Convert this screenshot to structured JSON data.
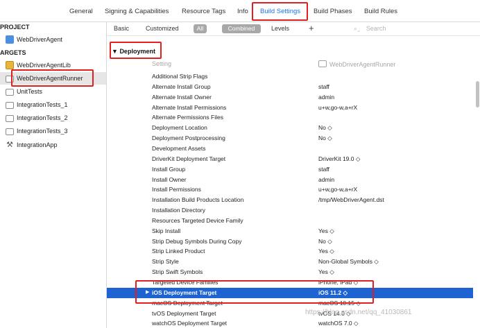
{
  "tabs": {
    "general": "General",
    "signing": "Signing & Capabilities",
    "resource_tags": "Resource Tags",
    "info": "Info",
    "build_settings": "Build Settings",
    "build_phases": "Build Phases",
    "build_rules": "Build Rules"
  },
  "sidebar": {
    "project_header": "PROJECT",
    "project_item": "WebDriverAgent",
    "targets_header": "ARGETS",
    "targets": {
      "t0": "WebDriverAgentLib",
      "t1": "WebDriverAgentRunner",
      "t2": "UnitTests",
      "t3": "IntegrationTests_1",
      "t4": "IntegrationTests_2",
      "t5": "IntegrationTests_3",
      "t6": "IntegrationApp"
    }
  },
  "filter": {
    "basic": "Basic",
    "customized": "Customized",
    "all": "All",
    "combined": "Combined",
    "levels": "Levels",
    "plus": "+",
    "search_placeholder": "Search"
  },
  "section": {
    "title": "Deployment",
    "col_setting": "Setting",
    "col_target": "WebDriverAgentRunner"
  },
  "settings": [
    {
      "name": "Additional Strip Flags",
      "value": ""
    },
    {
      "name": "Alternate Install Group",
      "value": "staff"
    },
    {
      "name": "Alternate Install Owner",
      "value": "admin"
    },
    {
      "name": "Alternate Install Permissions",
      "value": "u+w,go-w,a+rX"
    },
    {
      "name": "Alternate Permissions Files",
      "value": ""
    },
    {
      "name": "Deployment Location",
      "value": "No ◇"
    },
    {
      "name": "Deployment Postprocessing",
      "value": "No ◇"
    },
    {
      "name": "Development Assets",
      "value": ""
    },
    {
      "name": "DriverKit Deployment Target",
      "value": "DriverKit 19.0 ◇"
    },
    {
      "name": "Install Group",
      "value": "staff"
    },
    {
      "name": "Install Owner",
      "value": "admin"
    },
    {
      "name": "Install Permissions",
      "value": "u+w,go-w,a+rX"
    },
    {
      "name": "Installation Build Products Location",
      "value": "/tmp/WebDriverAgent.dst"
    },
    {
      "name": "Installation Directory",
      "value": ""
    },
    {
      "name": "Resources Targeted Device Family",
      "value": ""
    },
    {
      "name": "Skip Install",
      "value": "Yes ◇"
    },
    {
      "name": "Strip Debug Symbols During Copy",
      "value": "No ◇"
    },
    {
      "name": "Strip Linked Product",
      "value": "Yes ◇"
    },
    {
      "name": "Strip Style",
      "value": "Non-Global Symbols ◇"
    },
    {
      "name": "Strip Swift Symbols",
      "value": "Yes ◇"
    },
    {
      "name": "Targeted Device Families",
      "value": "iPhone, iPad ◇"
    },
    {
      "name": "iOS Deployment Target",
      "value": "iOS 11.2 ◇"
    },
    {
      "name": "macOS Deployment Target",
      "value": "macOS 10.15 ◇"
    },
    {
      "name": "tvOS Deployment Target",
      "value": "tvOS 14.0 ◇"
    },
    {
      "name": "watchOS Deployment Target",
      "value": "watchOS 7.0 ◇"
    }
  ],
  "watermark": "https://blog.csdn.net/qq_41030861"
}
